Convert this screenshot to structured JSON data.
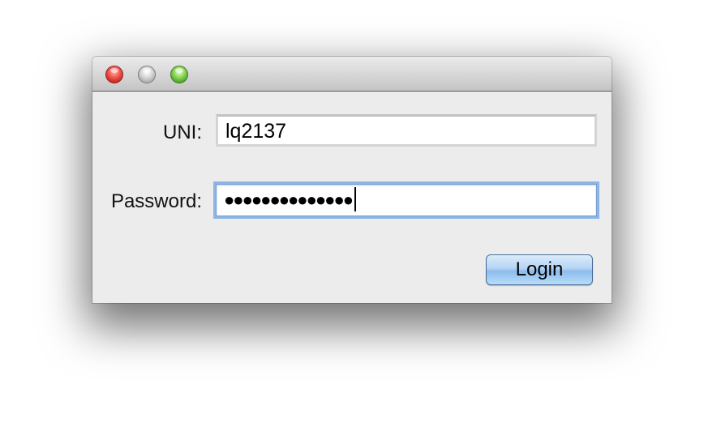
{
  "window": {
    "title": ""
  },
  "form": {
    "uni_label": "UNI:",
    "uni_value": "lq2137",
    "password_label": "Password:",
    "password_mask": "●●●●●●●●●●●●●●",
    "login_label": "Login"
  },
  "icons": {
    "close": "close-icon",
    "minimize": "minimize-icon",
    "zoom": "zoom-icon"
  },
  "colors": {
    "close": "#e0443c",
    "minimize": "#bdbdbd",
    "zoom": "#6bbd3f",
    "focus_ring": "#8bb5e8",
    "button": "#a9cff3"
  }
}
